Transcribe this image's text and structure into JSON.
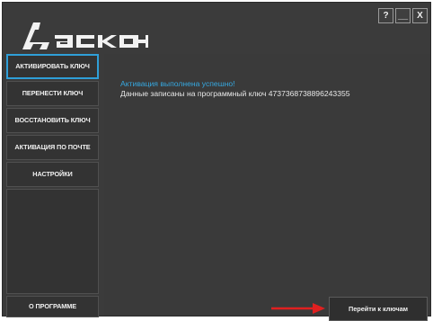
{
  "window_controls": {
    "help": "?",
    "minimize": "__",
    "close": "X"
  },
  "sidebar": {
    "items": [
      {
        "label": "АКТИВИРОВАТЬ КЛЮЧ",
        "active": true
      },
      {
        "label": "ПЕРЕНЕСТИ КЛЮЧ",
        "active": false
      },
      {
        "label": "ВОССТАНОВИТЬ КЛЮЧ",
        "active": false
      },
      {
        "label": "АКТИВАЦИЯ ПО ПОЧТЕ",
        "active": false
      },
      {
        "label": "НАСТРОЙКИ",
        "active": false
      }
    ],
    "about_label": "О ПРОГРАММЕ"
  },
  "main": {
    "status_title": "Активация выполнена успешно!",
    "status_message": "Данные записаны на программный ключ 4737368738896243355"
  },
  "footer": {
    "go_to_keys_label": "Перейти к ключам"
  },
  "colors": {
    "accent": "#2f9fd8",
    "arrow": "#e02020",
    "background": "#3b3b3b"
  }
}
